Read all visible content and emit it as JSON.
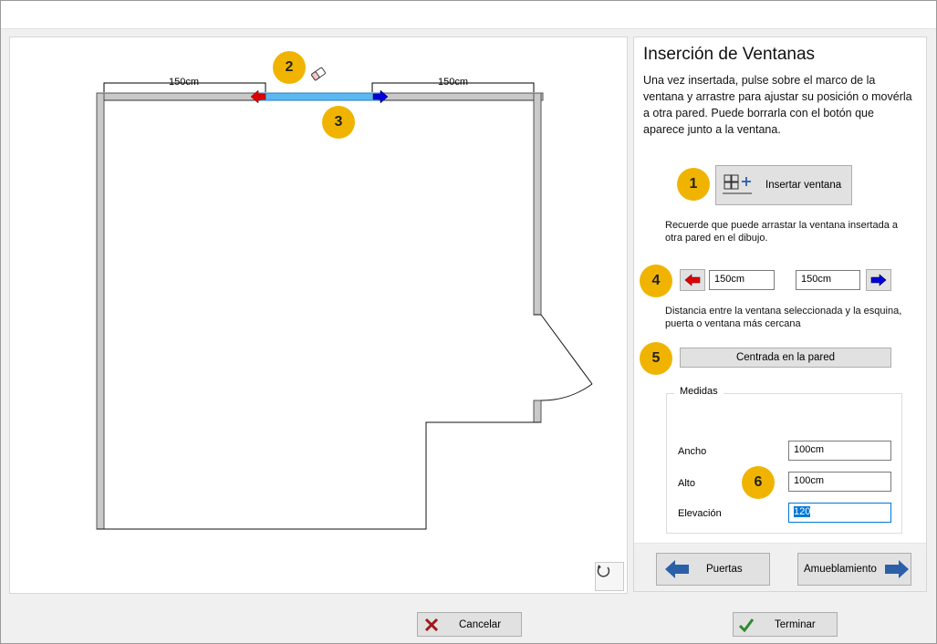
{
  "drawing": {
    "left_distance_label": "150cm",
    "right_distance_label": "150cm"
  },
  "panel": {
    "title": "Inserción de Ventanas",
    "description": "Una vez insertada, pulse sobre el marco de la ventana y arrastre para ajustar su posición o movérla a otra pared. Puede borrarla con el botón que aparece junto a la ventana.",
    "insert_window_label": "Insertar ventana",
    "drag_note": "Recuerde que puede arrastar la ventana insertada a otra pared en el dibujo.",
    "left_distance_value": "150cm",
    "right_distance_value": "150cm",
    "distance_note": "Distancia entre la ventana seleccionada y la esquina, puerta o ventana más cercana",
    "center_button_label": "Centrada en la pared",
    "measures": {
      "legend": "Medidas",
      "width_label": "Ancho",
      "width_value": "100cm",
      "height_label": "Alto",
      "height_value": "100cm",
      "elevation_label": "Elevación",
      "elevation_value": "120"
    },
    "prev_button_label": "Puertas",
    "next_button_label": "Amueblamiento"
  },
  "footer": {
    "cancel_label": "Cancelar",
    "finish_label": "Terminar"
  },
  "badges": {
    "b1": "1",
    "b2": "2",
    "b3": "3",
    "b4": "4",
    "b5": "5",
    "b6": "6"
  },
  "colors": {
    "badge": "#f0b400",
    "window_selected": "#5cb8f0",
    "arrow_left": "#e00000",
    "arrow_right": "#0000e0",
    "nav_arrow": "#2b5fa8"
  },
  "icons": {
    "eraser": "eraser-icon",
    "rotate": "rotate-icon",
    "cancel": "close-icon",
    "finish": "check-icon"
  }
}
